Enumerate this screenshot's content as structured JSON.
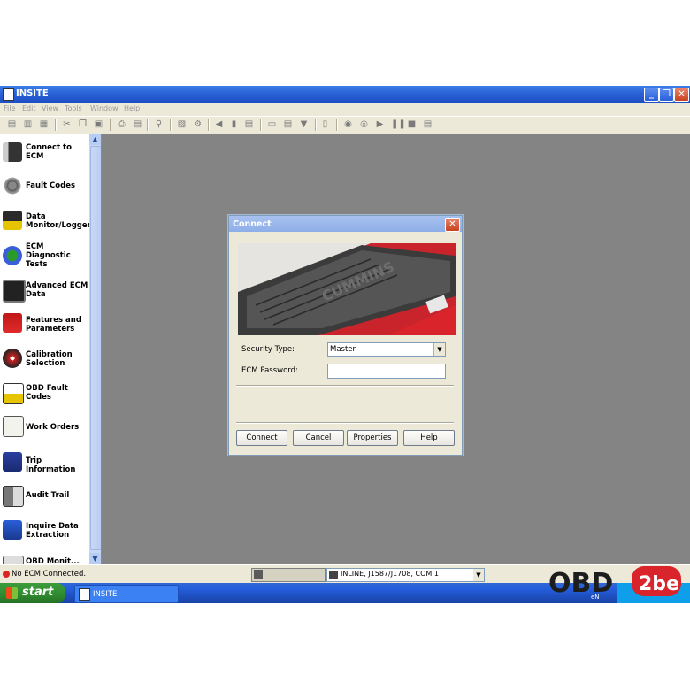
{
  "window": {
    "title": "INSITE",
    "controls": {
      "minimize": "_",
      "maximize": "❐",
      "close": "✕"
    }
  },
  "menu": [
    "File",
    "Edit",
    "View",
    "Tools",
    "Window",
    "Help"
  ],
  "toolbar": {
    "icons": [
      "open-icon",
      "save-icon",
      "save-all-icon",
      "cut-icon",
      "copy-icon",
      "paste-icon",
      "print-icon",
      "print-preview-icon",
      "find-icon",
      "report-icon",
      "settings-icon",
      "connect-icon",
      "download-icon",
      "upload-icon",
      "document-icon",
      "properties-icon",
      "filter-icon",
      "page-icon",
      "record-icon",
      "stop-record-icon",
      "play-icon",
      "pause-icon",
      "stop-icon",
      "export-icon"
    ]
  },
  "sidebar": {
    "items": [
      {
        "label": "Connect to ECM",
        "icon": "connector-icon"
      },
      {
        "label": "Fault Codes",
        "icon": "gears-icon"
      },
      {
        "label": "Data Monitor/Logger",
        "icon": "monitor-icon"
      },
      {
        "label": "ECM Diagnostic Tests",
        "icon": "flask-icon"
      },
      {
        "label": "Advanced ECM Data",
        "icon": "chip-icon"
      },
      {
        "label": "Features and Parameters",
        "icon": "toolbox-icon"
      },
      {
        "label": "Calibration Selection",
        "icon": "disc-icon"
      },
      {
        "label": "OBD Fault Codes",
        "icon": "obd-icon"
      },
      {
        "label": "Work Orders",
        "icon": "clipboard-icon"
      },
      {
        "label": "Trip Information",
        "icon": "truck-icon"
      },
      {
        "label": "Audit Trail",
        "icon": "audit-icon"
      },
      {
        "label": "Inquire Data Extraction",
        "icon": "extract-icon"
      },
      {
        "label": "OBD Monit...",
        "icon": "obd-monitor-icon"
      }
    ]
  },
  "status": {
    "text": "No ECM Connected.",
    "connection": "INLINE, J1587/J1708, COM 1"
  },
  "taskbar": {
    "start": "start",
    "task": "INSITE"
  },
  "dialog": {
    "title": "Connect",
    "image_text": "CUMMINS",
    "security_label": "Security Type:",
    "security_value": "Master",
    "password_label": "ECM Password:",
    "password_value": "",
    "buttons": {
      "connect": "Connect",
      "cancel": "Cancel",
      "properties": "Properties",
      "help": "Help"
    }
  },
  "watermark": {
    "text_main": "OBD",
    "text_badge": "2be",
    "text_small": "eN"
  },
  "colors": {
    "titlebar": "#2a62d6",
    "workspace": "#848484",
    "taskbar": "#245edb",
    "start": "#2f8a2f",
    "engine_red": "#d8242a"
  }
}
